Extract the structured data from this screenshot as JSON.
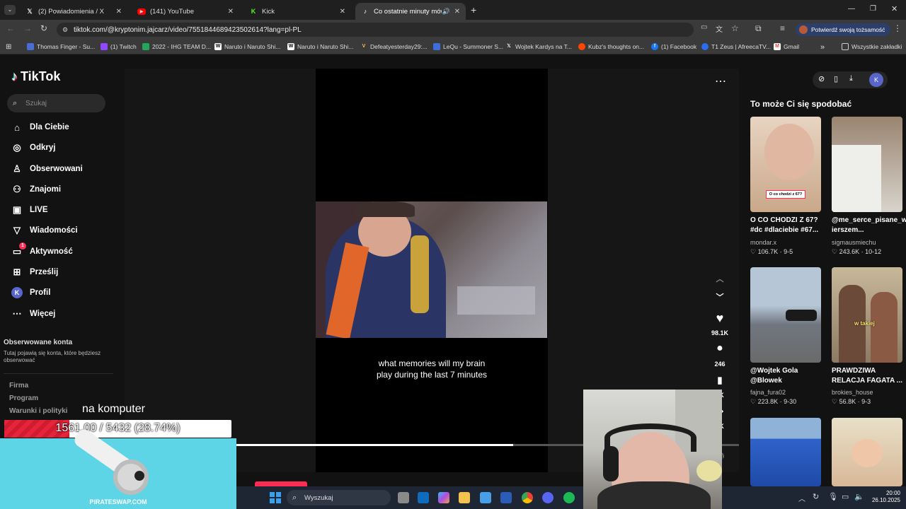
{
  "browser": {
    "tabs": [
      {
        "label": "(2) Powiadomienia / X",
        "icon": "x-icon"
      },
      {
        "label": "(141) YouTube",
        "icon": "youtube-icon"
      },
      {
        "label": "Kick",
        "icon": "kick-icon"
      },
      {
        "label": "Co ostatnie minuty mówią o...",
        "icon": "tiktok-icon"
      }
    ],
    "url": "tiktok.com/@kryptonim.jajcarz/video/7551844689423502614?lang=pl-PL",
    "verify_label": "Potwierdź swoją tożsamość",
    "bookmarks": [
      "Thomas Finger - Su...",
      "(1) Twitch",
      "2022 - IHG TEAM D...",
      "Naruto i Naruto Shi...",
      "Naruto i Naruto Shi...",
      "Defeatyesterday29:...",
      "LeQu - Summoner S...",
      "Wojtek Kardys na T...",
      "Kubz's thoughts on...",
      "(1) Facebook",
      "T1 Zeus | AfreecaTV...",
      "Gmail"
    ],
    "all_bookmarks": "Wszystkie zakładki"
  },
  "sidebar": {
    "logo": "TikTok",
    "search_placeholder": "Szukaj",
    "nav": [
      {
        "label": "Dla Ciebie",
        "icon": "home-icon"
      },
      {
        "label": "Odkryj",
        "icon": "compass-icon"
      },
      {
        "label": "Obserwowani",
        "icon": "user-follow-icon"
      },
      {
        "label": "Znajomi",
        "icon": "friends-icon"
      },
      {
        "label": "LIVE",
        "icon": "live-icon"
      },
      {
        "label": "Wiadomości",
        "icon": "send-icon"
      },
      {
        "label": "Aktywność",
        "icon": "inbox-icon",
        "badge": "1"
      },
      {
        "label": "Prześlij",
        "icon": "upload-icon"
      },
      {
        "label": "Profil",
        "icon": "avatar-icon"
      },
      {
        "label": "Więcej",
        "icon": "more-icon"
      }
    ],
    "followed_title": "Obserwowane konta",
    "followed_desc": "Tutaj pojawią się konta, które będziesz obserwować",
    "footer": [
      "Firma",
      "Program",
      "Warunki i polityki"
    ],
    "avatar_letter": "K"
  },
  "video": {
    "caption_line1": "what memories will my brain",
    "caption_line2": "play during the last 7 minutes",
    "likes": "98.1K",
    "comments": "246",
    "saves": "9K",
    "shares": "2K",
    "progress": 0.55
  },
  "recommendations": {
    "title": "To może Ci się spodobać",
    "items": [
      {
        "title": "O CO CHODZI Z 67? #dc #dlaciebie #67...",
        "author": "mondar.x",
        "likes": "106.7K",
        "date": "9-5",
        "thumb_text": "O co chodzi z 67?"
      },
      {
        "title": "@me_serce_pisane_w ierszem...",
        "author": "sigmausmiechu",
        "likes": "243.6K",
        "date": "10-12"
      },
      {
        "title": "@Wojtek Gola @Blowek",
        "author": "fajna_fura02",
        "likes": "223.8K",
        "date": "9-30"
      },
      {
        "title": "PRAWDZIWA RELACJA FAGATA ...",
        "author": "brokies_house",
        "likes": "56.8K",
        "date": "9-3",
        "thumb_text": "w takiej"
      }
    ]
  },
  "overlay": {
    "text": "na komputer",
    "goal": "1561.00 / 5432 (28.74%)",
    "goal_fraction": 0.2874,
    "promo": "PIRATESWAP.COM"
  },
  "taskbar": {
    "search": "Wyszukaj",
    "time": "20:00",
    "date": "26.10.2025"
  }
}
